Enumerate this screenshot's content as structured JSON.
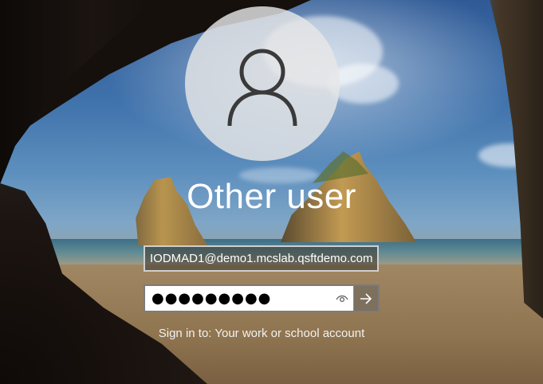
{
  "user": {
    "display_name": "Other user",
    "avatar_icon": "user-icon"
  },
  "login": {
    "username_value": "IODMAD1@demo1.mcslab.qsftdemo.com",
    "password_masked": "●●●●●●●●●",
    "reveal_icon": "eye-icon",
    "submit_icon": "arrow-right-icon"
  },
  "signin_target": "Sign in to: Your work or school account"
}
